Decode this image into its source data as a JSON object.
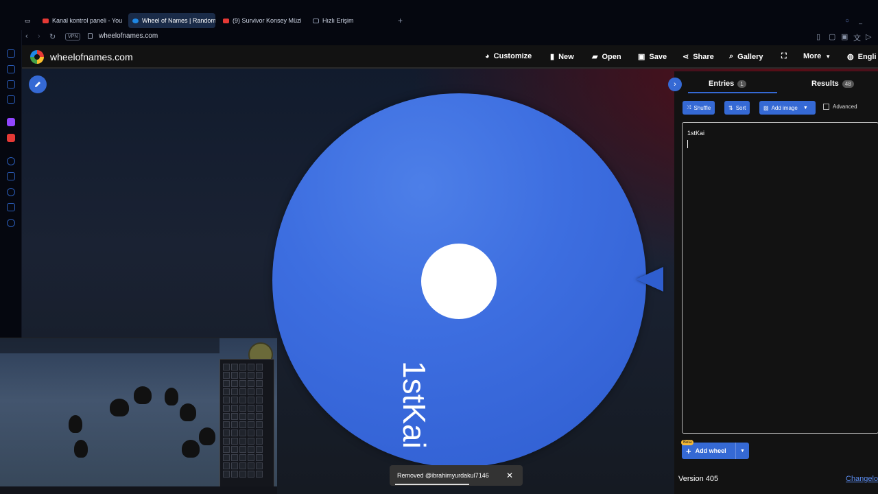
{
  "browser": {
    "tabs": [
      {
        "label": "Kanal kontrol paneli - You",
        "active": false,
        "fav": "#e53935"
      },
      {
        "label": "Wheel of Names | Random",
        "active": true,
        "fav": "#1e88e5"
      },
      {
        "label": "(9) Survivor Konsey Müzi",
        "active": false,
        "fav": "#e53935"
      },
      {
        "label": "Hızlı Erişim",
        "active": false,
        "fav": "#8a94a8"
      }
    ],
    "vpn_label": "VPN",
    "url": "wheelofnames.com"
  },
  "site": {
    "name": "wheelofnames.com",
    "menu": {
      "customize": "Customize",
      "new": "New",
      "open": "Open",
      "save": "Save",
      "share": "Share",
      "gallery": "Gallery",
      "more": "More",
      "language": "Engli"
    }
  },
  "wheel": {
    "entries": [
      "1stKai"
    ],
    "color": "#3d6ee0"
  },
  "panel": {
    "entries_tab": "Entries",
    "entries_count": "1",
    "results_tab": "Results",
    "results_count": "48",
    "shuffle": "Shuffle",
    "sort": "Sort",
    "add_image": "Add image",
    "advanced": "Advanced",
    "entries_text": "1stKai",
    "add_wheel": "Add wheel",
    "beta": "Beta",
    "version": "Version 405",
    "changelog": "Changelo"
  },
  "toast": {
    "message": "Removed @ibrahimyurdakul7146"
  },
  "colors": {
    "accent": "#3569d4",
    "topbar": "#121212"
  }
}
